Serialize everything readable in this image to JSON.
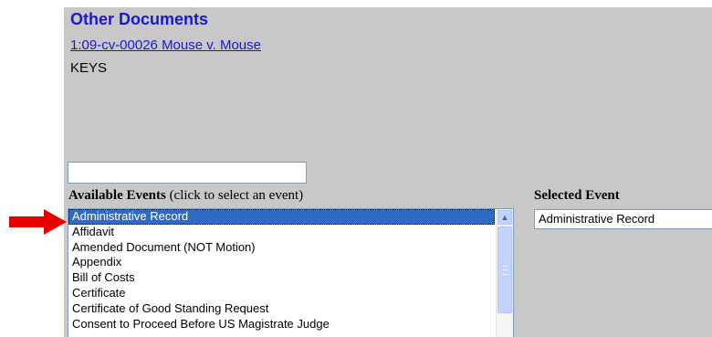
{
  "page": {
    "title": "Other Documents",
    "case_link": "1:09-cv-00026 Mouse v. Mouse",
    "keys": "KEYS"
  },
  "search": {
    "value": ""
  },
  "available_events": {
    "label_bold": "Available Events",
    "label_hint": " (click to select an event)",
    "items": [
      "Administrative Record",
      "Affidavit",
      "Amended Document (NOT Motion)",
      "Appendix",
      "Bill of Costs",
      "Certificate",
      "Certificate of Good Standing Request",
      "Consent to Proceed Before US Magistrate Judge"
    ],
    "selected_index": 0
  },
  "selected_event": {
    "label": "Selected Event",
    "value": "Administrative Record"
  },
  "colors": {
    "panel_bg": "#c8c8c8",
    "heading_blue": "#1a1acc",
    "selection_blue": "#316ac5",
    "arrow_red": "#e60000"
  },
  "icons": {
    "pointer": "red-arrow-icon",
    "scroll_up": "chevron-up-icon"
  }
}
